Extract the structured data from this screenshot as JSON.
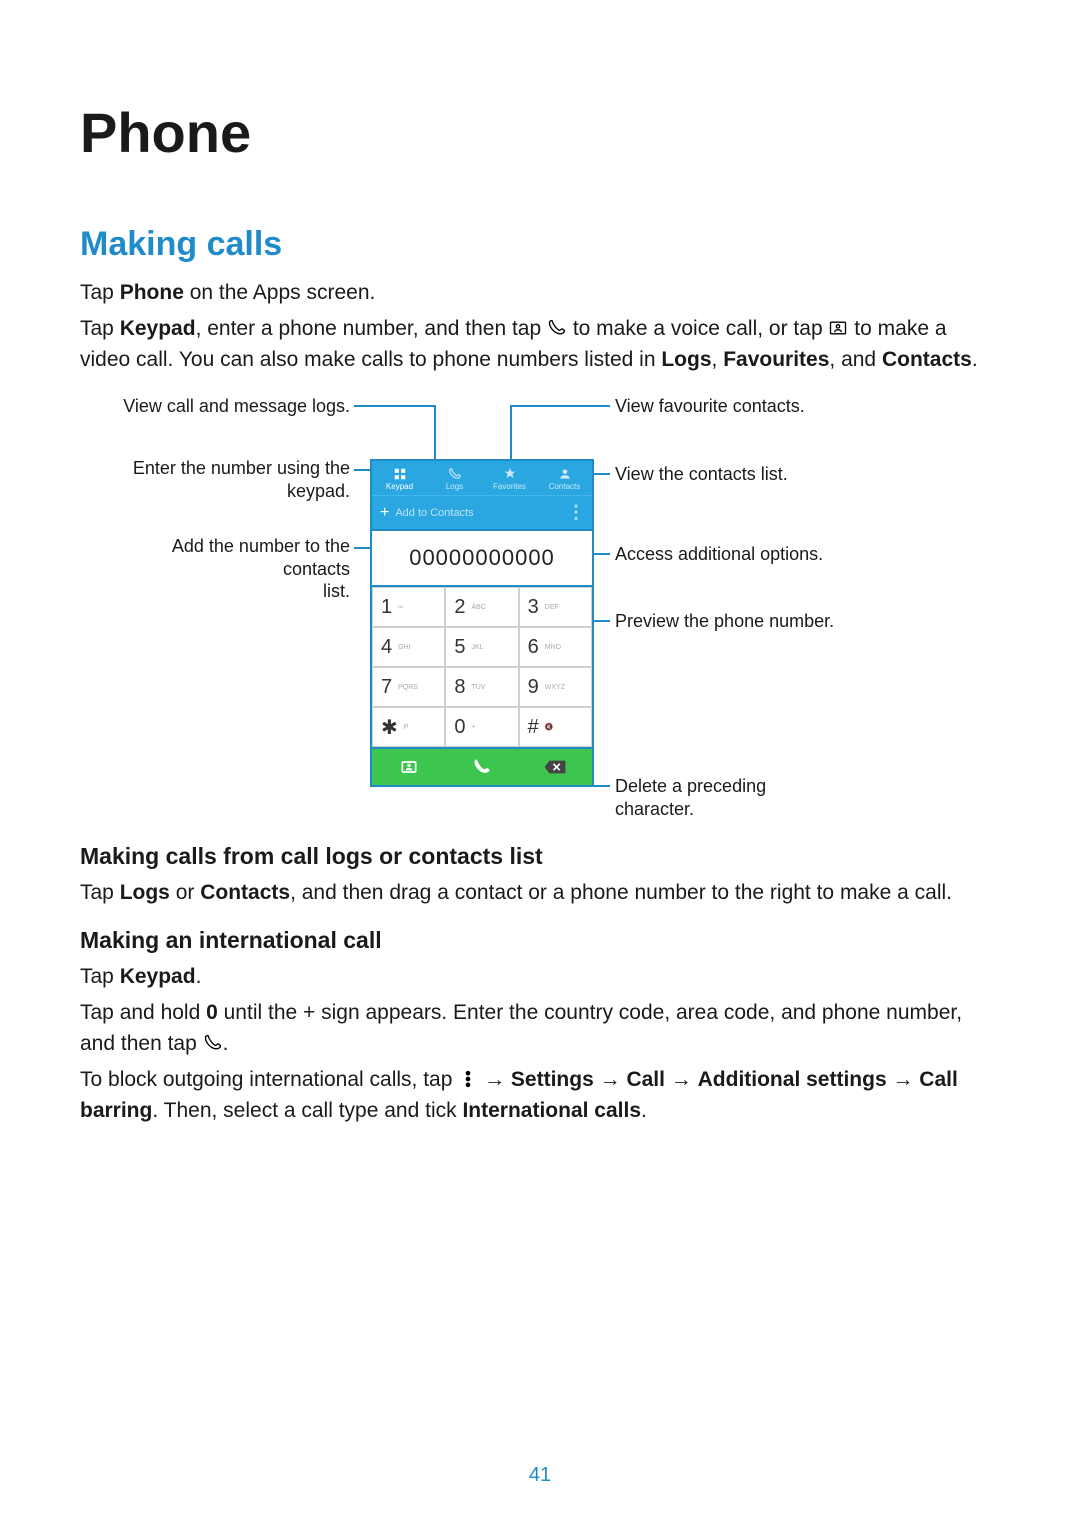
{
  "page_title": "Phone",
  "section_heading": "Making calls",
  "intro_line_pre": "Tap ",
  "intro_phone": "Phone",
  "intro_line_post": " on the Apps screen.",
  "p2": {
    "pre": "Tap ",
    "keypad": "Keypad",
    "mid1": ", enter a phone number, and then tap ",
    "mid2": " to make a voice call, or tap ",
    "mid3": " to make a video call. You can also make calls to phone numbers listed in ",
    "logs": "Logs",
    "sep1": ", ",
    "fav": "Favourites",
    "sep2": ", and ",
    "contacts": "Contacts",
    "end": "."
  },
  "callouts": {
    "l1": "View call and message logs.",
    "l2_a": "Enter the number using the",
    "l2_b": "keypad.",
    "l3_a": "Add the number to the contacts",
    "l3_b": "list.",
    "r1": "View favourite contacts.",
    "r2": "View the contacts list.",
    "r3": "Access additional options.",
    "r4": "Preview the phone number.",
    "r5": "Delete a preceding character."
  },
  "phone": {
    "tabs": [
      "Keypad",
      "Logs",
      "Favorites",
      "Contacts"
    ],
    "add_label": "Add to Contacts",
    "number": "00000000000",
    "keys": [
      {
        "d": "1",
        "l": "∞"
      },
      {
        "d": "2",
        "l": "ABC"
      },
      {
        "d": "3",
        "l": "DEF"
      },
      {
        "d": "4",
        "l": "GHI"
      },
      {
        "d": "5",
        "l": "JKL"
      },
      {
        "d": "6",
        "l": "MNO"
      },
      {
        "d": "7",
        "l": "PQRS"
      },
      {
        "d": "8",
        "l": "TUV"
      },
      {
        "d": "9",
        "l": "WXYZ"
      },
      {
        "d": "✱",
        "l": "P"
      },
      {
        "d": "0",
        "l": "+"
      },
      {
        "d": "#",
        "l": "🔇"
      }
    ]
  },
  "sub1_heading": "Making calls from call logs or contacts list",
  "sub1_p": {
    "pre": "Tap ",
    "logs": "Logs",
    "or": " or ",
    "contacts": "Contacts",
    "post": ", and then drag a contact or a phone number to the right to make a call."
  },
  "sub2_heading": "Making an international call",
  "sub2_l1_pre": "Tap ",
  "sub2_l1_bold": "Keypad",
  "sub2_l1_post": ".",
  "sub2_l2_pre": "Tap and hold ",
  "sub2_l2_bold": "0",
  "sub2_l2_mid": " until the + sign appears. Enter the country code, area code, and phone number, and then tap ",
  "sub2_l2_post": ".",
  "sub2_l3": {
    "pre": "To block outgoing international calls, tap ",
    "s1": " → ",
    "settings": "Settings",
    "s2": " → ",
    "call": "Call",
    "s3": " → ",
    "add": "Additional settings",
    "s4": " → ",
    "barring": "Call barring",
    "mid": ". Then, select a call type and tick ",
    "intl": "International calls",
    "end": "."
  },
  "page_number": "41"
}
